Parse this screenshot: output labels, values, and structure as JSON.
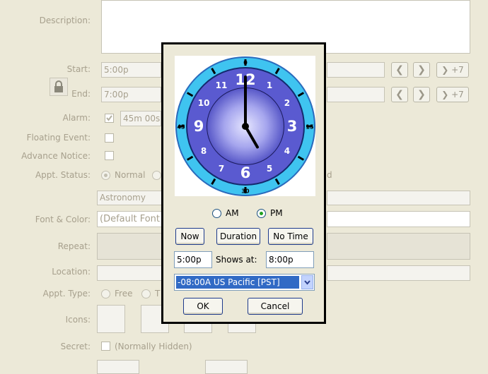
{
  "form": {
    "description_label": "Description:",
    "start_label": "Start:",
    "start_value": "5:00p",
    "end_label": "End:",
    "end_value": "7:00p",
    "plus7": "+7",
    "alarm_label": "Alarm:",
    "alarm_value": "45m 00s",
    "floating_label": "Floating Event:",
    "advance_label": "Advance Notice:",
    "status_label": "Appt. Status:",
    "status_normal": "Normal",
    "status_fragment": "d",
    "category_value": "Astronomy",
    "font_label": "Font & Color:",
    "font_value": "(Default Font",
    "repeat_label": "Repeat:",
    "location_label": "Location:",
    "type_label": "Appt. Type:",
    "type_free": "Free",
    "type_fragment": "T",
    "icons_label": "Icons:",
    "secret_label": "Secret:",
    "secret_hint": "(Normally Hidden)"
  },
  "icons": {
    "prev": "❮",
    "next": "❯"
  },
  "popup": {
    "clock": {
      "numbers": [
        "12",
        "1",
        "2",
        "3",
        "4",
        "5",
        "6",
        "7",
        "8",
        "9",
        "10",
        "11"
      ],
      "minute_labels": [
        "0",
        "15",
        "30",
        "45"
      ],
      "hour": 5,
      "minute": 0
    },
    "am": "AM",
    "pm": "PM",
    "selected_period": "PM",
    "now": "Now",
    "duration": "Duration",
    "no_time": "No Time",
    "time_value": "5:00p",
    "shows_at": "Shows at:",
    "shows_value": "8:00p",
    "timezone": "-08:00A US Pacific [PST]",
    "ok": "OK",
    "cancel": "Cancel"
  },
  "colors": {
    "clock_outer_ring": "#3fc4f0",
    "clock_face": "#5a5ad0",
    "selection": "#316ac5",
    "disabled_text": "#a7a08d"
  }
}
